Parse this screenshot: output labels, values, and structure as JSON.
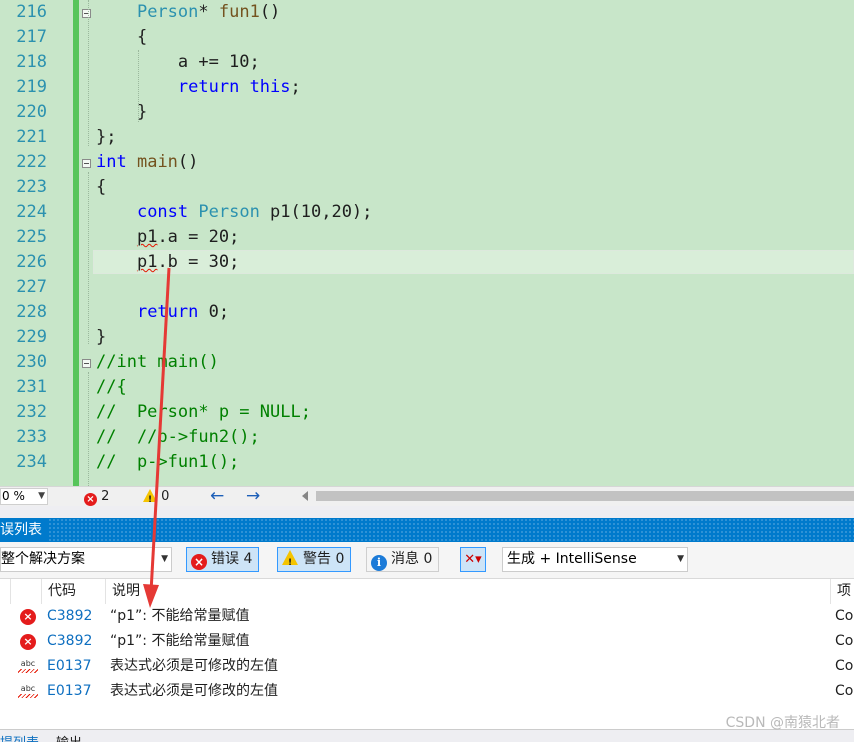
{
  "editor": {
    "line_numbers": [
      "216",
      "217",
      "218",
      "219",
      "220",
      "221",
      "222",
      "223",
      "224",
      "225",
      "226",
      "227",
      "228",
      "229",
      "230",
      "231",
      "232",
      "233",
      "234"
    ],
    "lines": [
      [
        {
          "t": "    "
        },
        {
          "t": "Person",
          "c": "ty"
        },
        {
          "t": "* "
        },
        {
          "t": "fun1",
          "c": "fn"
        },
        {
          "t": "()"
        }
      ],
      [
        {
          "t": "    {"
        }
      ],
      [
        {
          "t": "        a += 10;"
        }
      ],
      [
        {
          "t": "        "
        },
        {
          "t": "return",
          "c": "kw"
        },
        {
          "t": " "
        },
        {
          "t": "this",
          "c": "kw"
        },
        {
          "t": ";"
        }
      ],
      [
        {
          "t": "    }"
        }
      ],
      [
        {
          "t": "};"
        }
      ],
      [
        {
          "t": "int",
          "c": "kw"
        },
        {
          "t": " "
        },
        {
          "t": "main",
          "c": "fn"
        },
        {
          "t": "()"
        }
      ],
      [
        {
          "t": "{"
        }
      ],
      [
        {
          "t": "    "
        },
        {
          "t": "const",
          "c": "kw"
        },
        {
          "t": " "
        },
        {
          "t": "Person",
          "c": "ty"
        },
        {
          "t": " p1(10,20);"
        }
      ],
      [
        {
          "t": "    "
        },
        {
          "t": "p1",
          "c": "squig"
        },
        {
          "t": ".a = 20;"
        }
      ],
      [
        {
          "t": "    "
        },
        {
          "t": "p1",
          "c": "squig"
        },
        {
          "t": ".b = 30;"
        }
      ],
      [
        {
          "t": ""
        }
      ],
      [
        {
          "t": "    "
        },
        {
          "t": "return",
          "c": "kw"
        },
        {
          "t": " 0;"
        }
      ],
      [
        {
          "t": "}"
        }
      ],
      [
        {
          "t": "//int main()",
          "c": "cm"
        }
      ],
      [
        {
          "t": "//{",
          "c": "cm"
        }
      ],
      [
        {
          "t": "//  Person* p = NULL;",
          "c": "cm"
        }
      ],
      [
        {
          "t": "//  //p->fun2();",
          "c": "cm"
        }
      ],
      [
        {
          "t": "//  p->fun1();",
          "c": "cm"
        }
      ]
    ]
  },
  "status": {
    "zoom": "0 %",
    "error_count": "2",
    "warning_count": "0",
    "nav_back": "←",
    "nav_forward": "→"
  },
  "panel": {
    "title": "误列表",
    "scope": "整个解决方案",
    "errors_label": "错误 4",
    "warnings_label": "警告 0",
    "messages_label": "消息 0",
    "build_filter": "生成 + IntelliSense",
    "columns": {
      "code": "代码",
      "desc": "说明",
      "project": "项目"
    },
    "rows": [
      {
        "icon": "error",
        "code": "C3892",
        "desc": "“p1”: 不能给常量赋值",
        "project": "Co"
      },
      {
        "icon": "spell",
        "code": "C3892",
        "desc": "“p1”: 不能给常量赋值",
        "project": "Co"
      },
      {
        "icon": "abc",
        "code": "E0137",
        "desc": "表达式必须是可修改的左值",
        "project": "Co"
      },
      {
        "icon": "abc",
        "code": "E0137",
        "desc": "表达式必须是可修改的左值",
        "project": "Co"
      }
    ],
    "bottom_tabs": [
      "提列表",
      "输出"
    ]
  },
  "watermark": "CSDN @南猿北者",
  "colors": {
    "editor_bg": "#c8e6c9",
    "accent": "#007acc",
    "error": "#e41c1c",
    "annotation": "#e53935"
  }
}
